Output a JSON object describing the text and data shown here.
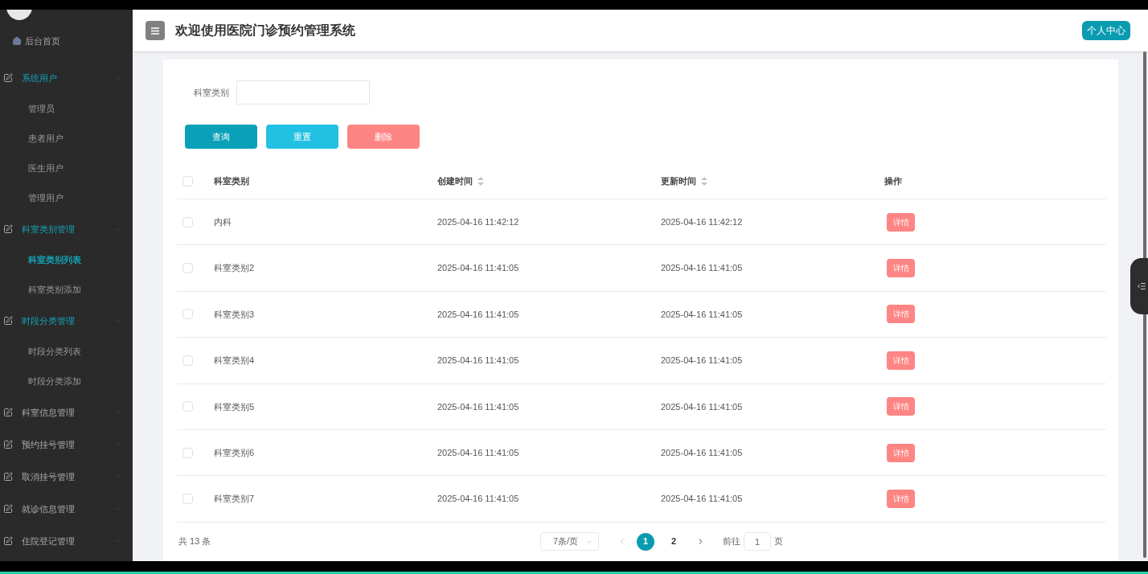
{
  "sidebar": {
    "home": "后台首页",
    "groups": [
      {
        "label": "系统用户",
        "expanded": true,
        "children": [
          {
            "label": "管理员",
            "selected": false
          },
          {
            "label": "患者用户",
            "selected": false
          },
          {
            "label": "医生用户",
            "selected": false
          },
          {
            "label": "管理用户",
            "selected": false
          }
        ]
      },
      {
        "label": "科室类别管理",
        "expanded": true,
        "children": [
          {
            "label": "科室类别列表",
            "selected": true
          },
          {
            "label": "科室类别添加",
            "selected": false
          }
        ]
      },
      {
        "label": "时段分类管理",
        "expanded": true,
        "children": [
          {
            "label": "时段分类列表",
            "selected": false
          },
          {
            "label": "时段分类添加",
            "selected": false
          }
        ]
      },
      {
        "label": "科室信息管理",
        "expanded": false
      },
      {
        "label": "预约挂号管理",
        "expanded": false
      },
      {
        "label": "取消挂号管理",
        "expanded": false
      },
      {
        "label": "就诊信息管理",
        "expanded": false
      },
      {
        "label": "住院登记管理",
        "expanded": false
      }
    ]
  },
  "header": {
    "title": "欢迎使用医院门诊预约管理系统",
    "profile_button": "个人中心"
  },
  "search": {
    "label": "科室类别",
    "buttons": [
      {
        "label": "查询",
        "kind": "query"
      },
      {
        "label": "重置",
        "kind": "reset"
      },
      {
        "label": "删除",
        "kind": "delete"
      }
    ]
  },
  "table": {
    "select_all_checked": false,
    "columns": [
      {
        "label": "科室类别",
        "sortable": false
      },
      {
        "label": "创建时间",
        "sortable": true
      },
      {
        "label": "更新时间",
        "sortable": true
      },
      {
        "label": "操作",
        "sortable": false
      }
    ],
    "rows": [
      {
        "checked": false,
        "name": "内科",
        "created": "2025-04-16 11:42:12",
        "updated": "2025-04-16 11:42:12",
        "action": "详情"
      },
      {
        "checked": false,
        "name": "科室类别2",
        "created": "2025-04-16 11:41:05",
        "updated": "2025-04-16 11:41:05",
        "action": "详情"
      },
      {
        "checked": false,
        "name": "科室类别3",
        "created": "2025-04-16 11:41:05",
        "updated": "2025-04-16 11:41:05",
        "action": "详情"
      },
      {
        "checked": false,
        "name": "科室类别4",
        "created": "2025-04-16 11:41:05",
        "updated": "2025-04-16 11:41:05",
        "action": "详情"
      },
      {
        "checked": false,
        "name": "科室类别5",
        "created": "2025-04-16 11:41:05",
        "updated": "2025-04-16 11:41:05",
        "action": "详情"
      },
      {
        "checked": false,
        "name": "科室类别6",
        "created": "2025-04-16 11:41:05",
        "updated": "2025-04-16 11:41:05",
        "action": "详情"
      },
      {
        "checked": false,
        "name": "科室类别7",
        "created": "2025-04-16 11:41:05",
        "updated": "2025-04-16 11:41:05",
        "action": "详情"
      }
    ]
  },
  "pagination": {
    "total": "共 13 条",
    "page_size": "7条/页",
    "pages": [
      {
        "label": "1",
        "selected": true
      },
      {
        "label": "2",
        "selected": false
      }
    ],
    "goto_label": "前往",
    "goto_value": "1",
    "goto_suffix": "页"
  }
}
